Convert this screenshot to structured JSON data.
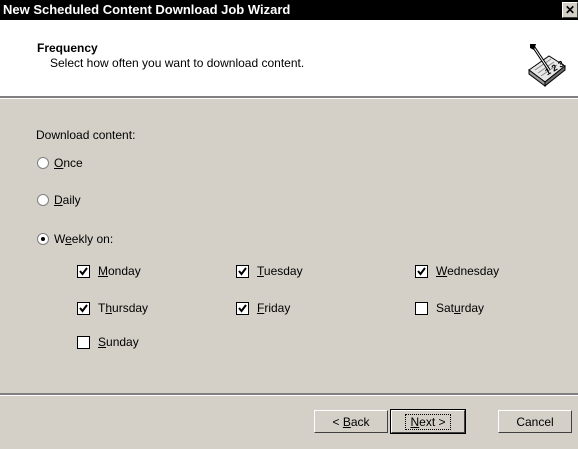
{
  "window": {
    "title": "New Scheduled Content Download Job Wizard",
    "close_label": "✕"
  },
  "header": {
    "title": "Frequency",
    "subtitle": "Select how often you want to download content.",
    "icon": "wizard-book-icon"
  },
  "frequency": {
    "group_label": "Download content:",
    "options": [
      {
        "pre": "",
        "key": "O",
        "post": "nce",
        "selected": false
      },
      {
        "pre": "",
        "key": "D",
        "post": "aily",
        "selected": false
      },
      {
        "pre": "W",
        "key": "e",
        "post": "ekly on:",
        "selected": true
      }
    ]
  },
  "days": [
    {
      "pre": "",
      "key": "M",
      "post": "onday",
      "checked": true
    },
    {
      "pre": "",
      "key": "T",
      "post": "uesday",
      "checked": true
    },
    {
      "pre": "",
      "key": "W",
      "post": "ednesday",
      "checked": true
    },
    {
      "pre": "T",
      "key": "h",
      "post": "ursday",
      "checked": true
    },
    {
      "pre": "",
      "key": "F",
      "post": "riday",
      "checked": true
    },
    {
      "pre": "Sat",
      "key": "u",
      "post": "rday",
      "checked": false
    },
    {
      "pre": "",
      "key": "S",
      "post": "unday",
      "checked": false
    }
  ],
  "buttons": {
    "back": {
      "pre": "< ",
      "key": "B",
      "post": "ack"
    },
    "next": {
      "pre": "",
      "key": "N",
      "post": "ext >"
    },
    "cancel": "Cancel"
  }
}
